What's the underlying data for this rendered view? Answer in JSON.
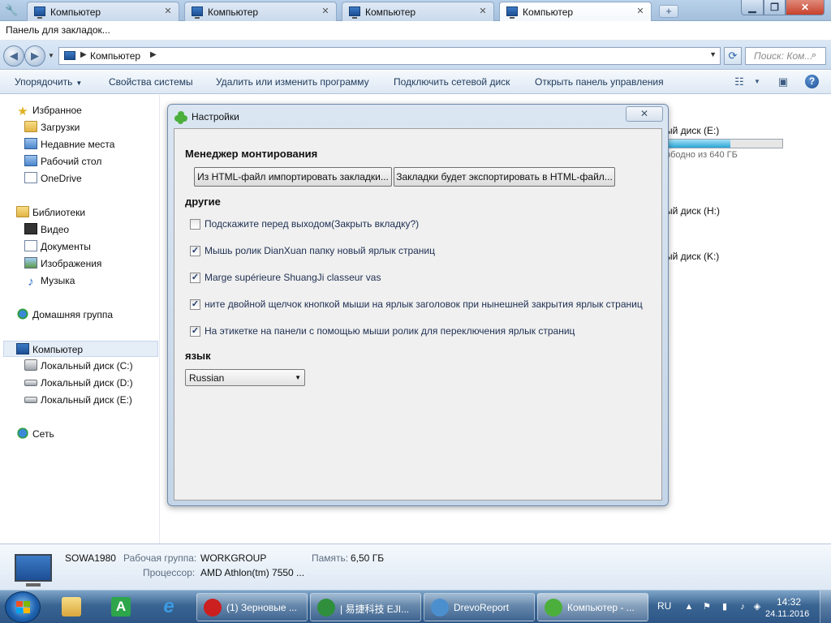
{
  "tabs": [
    {
      "title": "Компьютер",
      "close": "✕"
    },
    {
      "title": "Компьютер",
      "close": "✕"
    },
    {
      "title": "Компьютер",
      "close": "✕"
    },
    {
      "title": "Компьютер",
      "close": "✕"
    }
  ],
  "new_tab_label": "+",
  "bookmarks_bar": {
    "label": "Панель для закладок..."
  },
  "address_bar": {
    "location": "Компьютер",
    "search_placeholder": "Поиск: Ком..."
  },
  "command_bar": {
    "organize": "Упорядочить",
    "system_properties": "Свойства системы",
    "uninstall": "Удалить или изменить программу",
    "map_drive": "Подключить сетевой диск",
    "control_panel": "Открыть панель управления"
  },
  "nav": {
    "favorites": "Избранное",
    "downloads": "Загрузки",
    "recent": "Недавние места",
    "desktop": "Рабочий стол",
    "onedrive": "OneDrive",
    "libraries": "Библиотеки",
    "video": "Видео",
    "documents": "Документы",
    "pictures": "Изображения",
    "music": "Музыка",
    "homegroup": "Домашняя группа",
    "computer": "Компьютер",
    "disk_c": "Локальный диск (C:)",
    "disk_d": "Локальный диск (D:)",
    "disk_e": "Локальный диск (E:)",
    "network": "Сеть"
  },
  "content": {
    "disk_e_name": "ый диск (E:)",
    "disk_e_free": "ободно из 640 ГБ",
    "disk_e_used_fraction": 0.55,
    "disk_h_name": "ый диск (H:)",
    "disk_k_name": "ый диск (K:)"
  },
  "details": {
    "computer_name": "SOWA1980",
    "workgroup_label": "Рабочая группа:",
    "workgroup_value": "WORKGROUP",
    "memory_label": "Память:",
    "memory_value": "6,50 ГБ",
    "cpu_label": "Процессор:",
    "cpu_value": "AMD Athlon(tm) 7550 ..."
  },
  "dialog": {
    "title": "Настройки",
    "close": "✕",
    "mount_manager": "Менеджер монтирования",
    "import_button": "Из HTML-файл импортировать закладки...",
    "export_button": "Закладки будет экспортировать в HTML-файл...",
    "other_header": "другие",
    "options": [
      {
        "label": "Подскажите перед выходом(Закрыть вкладку?)",
        "checked": false
      },
      {
        "label": "Мышь ролик DianXuan папку новый ярлык страниц",
        "checked": true
      },
      {
        "label": "Marge supérieure ShuangJi classeur vas",
        "checked": true
      },
      {
        "label": "ните двойной щелчок кнопкой мыши на ярлык заголовок при нынешней закрытия ярлык страниц",
        "checked": true
      },
      {
        "label": "На этикетке на панели с помощью мыши ролик для переключения ярлык страниц",
        "checked": true
      }
    ],
    "language_header": "язык",
    "language_value": "Russian"
  },
  "taskbar": {
    "tasks": [
      {
        "label": "(1) Зерновые ...",
        "icon": "opera-icon",
        "color": "#cc1f1f"
      },
      {
        "label": "| 易捷科技 EJI...",
        "icon": "chrome-icon",
        "color": "#2f8f3c"
      },
      {
        "label": "DrevoReport",
        "icon": "drevo-icon",
        "color": "#4b8fcf"
      },
      {
        "label": "Компьютер - ...",
        "icon": "clover-icon",
        "color": "#4caf3c"
      }
    ],
    "language": "RU",
    "time": "14:32",
    "date": "24.11.2016"
  }
}
